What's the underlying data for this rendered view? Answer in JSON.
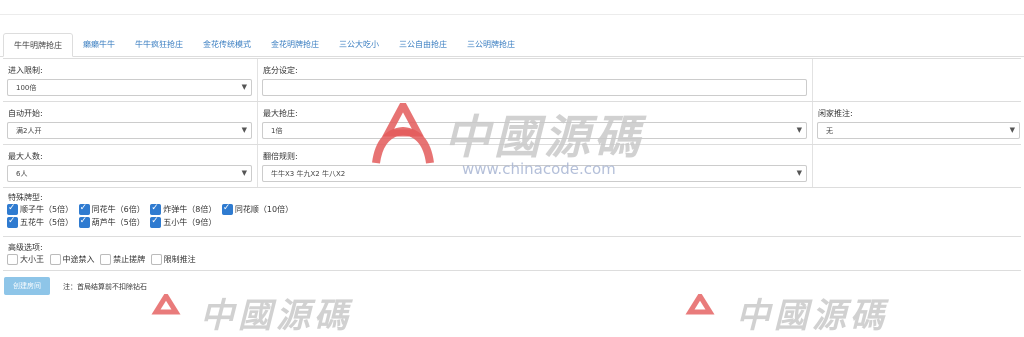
{
  "tabs": [
    {
      "label": "牛牛明牌抢庄",
      "active": true
    },
    {
      "label": "癞癞牛牛",
      "active": false
    },
    {
      "label": "牛牛疯狂抢庄",
      "active": false
    },
    {
      "label": "金花传统模式",
      "active": false
    },
    {
      "label": "金花明牌抢庄",
      "active": false
    },
    {
      "label": "三公大吃小",
      "active": false
    },
    {
      "label": "三公自由抢庄",
      "active": false
    },
    {
      "label": "三公明牌抢庄",
      "active": false
    }
  ],
  "form": {
    "entry_limit": {
      "label": "进入限制:",
      "value": "100倍"
    },
    "base_score": {
      "label": "底分设定:",
      "value": ""
    },
    "auto_start": {
      "label": "自动开始:",
      "value": "满2人开"
    },
    "max_banker": {
      "label": "最大抢庄:",
      "value": "1倍"
    },
    "idle_push": {
      "label": "闲家推注:",
      "value": "无"
    },
    "max_players": {
      "label": "最大人数:",
      "value": "6人"
    },
    "multiplier_rule": {
      "label": "翻倍规则:",
      "value": "牛牛X3 牛九X2 牛八X2"
    },
    "special_cards": {
      "label": "特殊牌型:",
      "items": [
        {
          "label": "顺子牛（5倍）",
          "checked": true
        },
        {
          "label": "同花牛（6倍）",
          "checked": true
        },
        {
          "label": "炸弹牛（8倍）",
          "checked": true
        },
        {
          "label": "同花顺（10倍）",
          "checked": true
        },
        {
          "label": "五花牛（5倍）",
          "checked": true
        },
        {
          "label": "葫芦牛（5倍）",
          "checked": true
        },
        {
          "label": "五小牛（9倍）",
          "checked": true
        }
      ]
    },
    "advanced": {
      "label": "高级选项:",
      "items": [
        {
          "label": "大小王",
          "checked": false
        },
        {
          "label": "中途禁入",
          "checked": false
        },
        {
          "label": "禁止搓牌",
          "checked": false
        },
        {
          "label": "限制推注",
          "checked": false
        }
      ]
    }
  },
  "actions": {
    "create_room": "创建房间",
    "note": "注：首局结算前不扣除钻石"
  },
  "watermark": {
    "text": "中國源碼",
    "url": "www.chinacode.com"
  },
  "icons": {
    "select_caret": "chevron-down-icon",
    "check": "checkmark-icon"
  },
  "colors": {
    "tab_link": "#3a7ec1",
    "check_on": "#2f7bd0",
    "button": "#8ec5e8"
  }
}
